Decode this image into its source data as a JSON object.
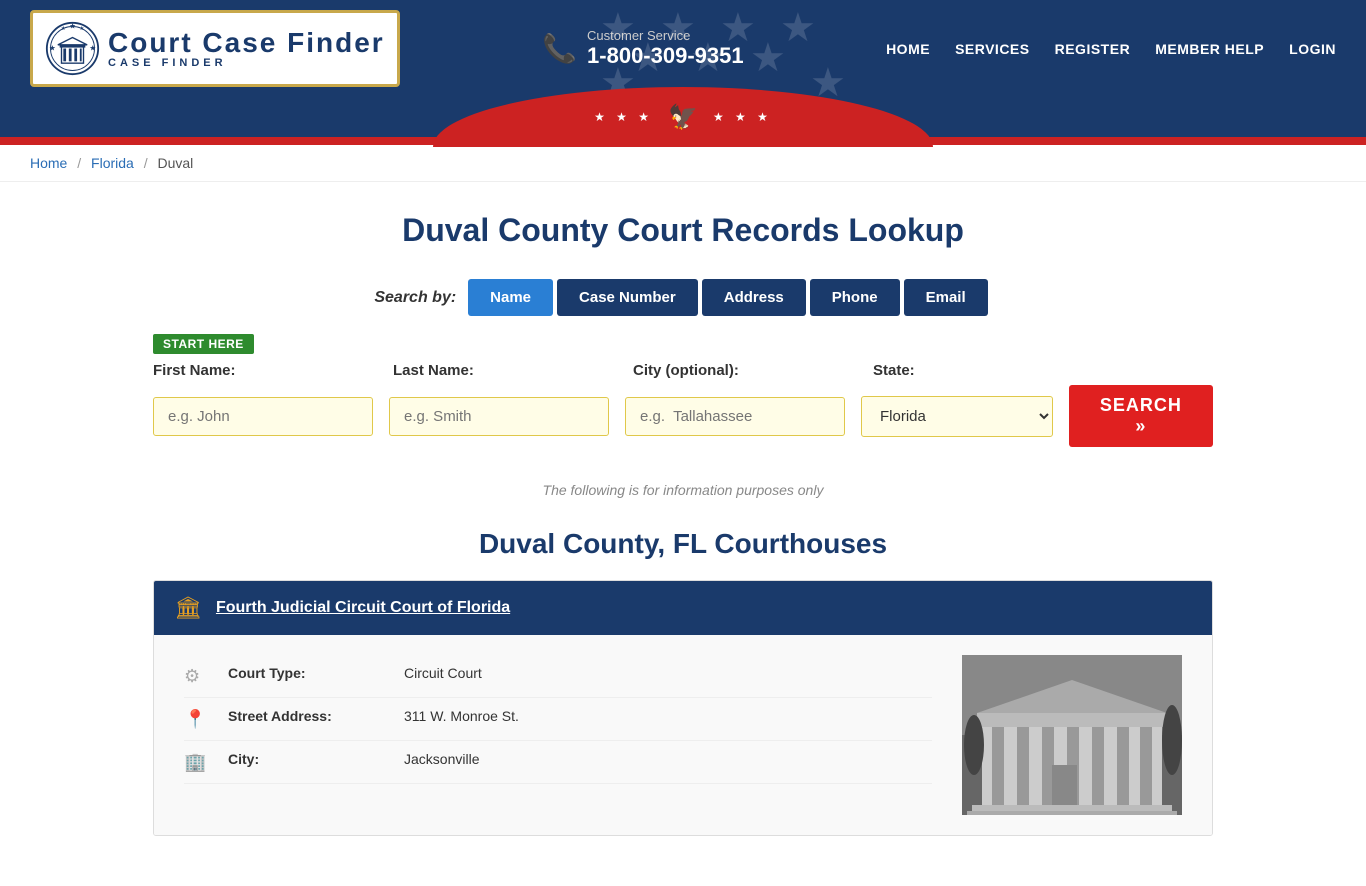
{
  "site": {
    "name": "Court Case Finder",
    "tagline": "CASE FINDER"
  },
  "header": {
    "customer_service_label": "Customer Service",
    "phone": "1-800-309-9351",
    "nav": {
      "home": "HOME",
      "services": "SERVICES",
      "register": "REGISTER",
      "member_help": "MEMBER HELP",
      "login": "LOGIN"
    }
  },
  "breadcrumb": {
    "home": "Home",
    "state": "Florida",
    "county": "Duval"
  },
  "page": {
    "title": "Duval County Court Records Lookup",
    "info_note": "The following is for information purposes only",
    "courthouses_title": "Duval County, FL Courthouses"
  },
  "search": {
    "label": "Search by:",
    "tabs": [
      {
        "id": "name",
        "label": "Name",
        "active": true
      },
      {
        "id": "case_number",
        "label": "Case Number",
        "active": false
      },
      {
        "id": "address",
        "label": "Address",
        "active": false
      },
      {
        "id": "phone",
        "label": "Phone",
        "active": false
      },
      {
        "id": "email",
        "label": "Email",
        "active": false
      }
    ],
    "start_here": "START HERE",
    "fields": {
      "first_name": {
        "label": "First Name:",
        "placeholder": "e.g. John"
      },
      "last_name": {
        "label": "Last Name:",
        "placeholder": "e.g. Smith"
      },
      "city": {
        "label": "City (optional):",
        "placeholder": "e.g.  Tallahassee"
      },
      "state": {
        "label": "State:",
        "value": "Florida"
      }
    },
    "button": "SEARCH »"
  },
  "courthouses": [
    {
      "name": "Fourth Judicial Circuit Court of Florida",
      "court_type": "Circuit Court",
      "street_address": "311 W. Monroe St.",
      "city": "Jacksonville"
    }
  ]
}
